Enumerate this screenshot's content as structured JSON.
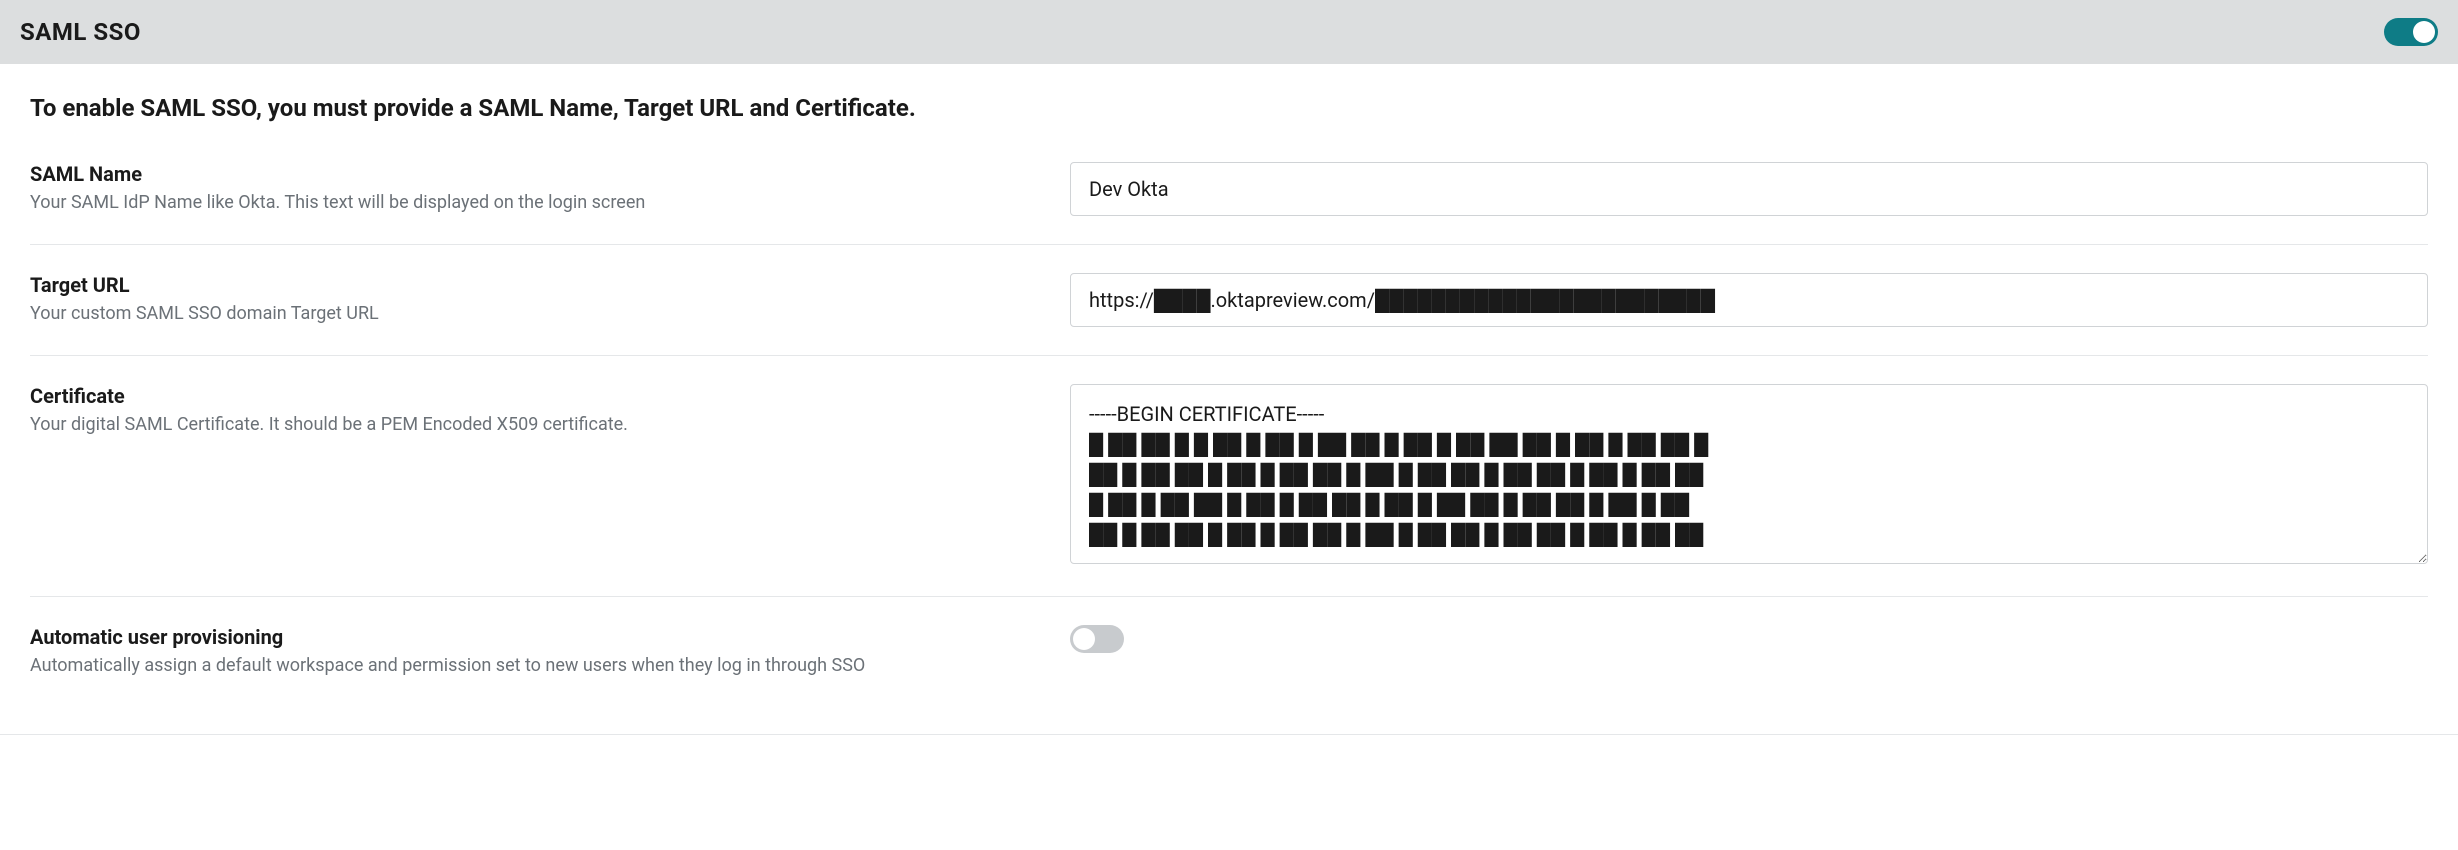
{
  "header": {
    "title": "SAML SSO",
    "enabled": true
  },
  "instruction": "To enable SAML SSO, you must provide a SAML Name, Target URL and Certificate.",
  "fields": {
    "samlName": {
      "label": "SAML Name",
      "description": "Your SAML IdP Name like Okta. This text will be displayed on the login screen",
      "value": "Dev Okta"
    },
    "targetUrl": {
      "label": "Target URL",
      "description": "Your custom SAML SSO domain Target URL",
      "value": "https://████.oktapreview.com/████████████████████████"
    },
    "certificate": {
      "label": "Certificate",
      "description": "Your digital SAML Certificate. It should be a PEM Encoded X509 certificate.",
      "value": "-----BEGIN CERTIFICATE-----\n█ ██ ██ █ █ ██ █ ██ █ ██ ██ █ ██ █ ██ ██ ██ █ ██ █ ██ ██ █\n██ █ ██ ██ █ ██ █ ██ ██ █ ██ █ ██ ██ █ ██ ██ █ ██ █ ██ ██\n█ ██ █ ██ ██ █ ██ █ ██ ██ █ ██ █ ██ ██ █ ██ ██ █ ██ █ ██\n██ █ ██ ██ █ ██ █ ██ ██ █ ██ █ ██ ██ █ ██ ██ █ ██ █ ██ ██"
    },
    "autoProvisioning": {
      "label": "Automatic user provisioning",
      "description": "Automatically assign a default workspace and permission set to new users when they log in through SSO",
      "enabled": false
    }
  }
}
